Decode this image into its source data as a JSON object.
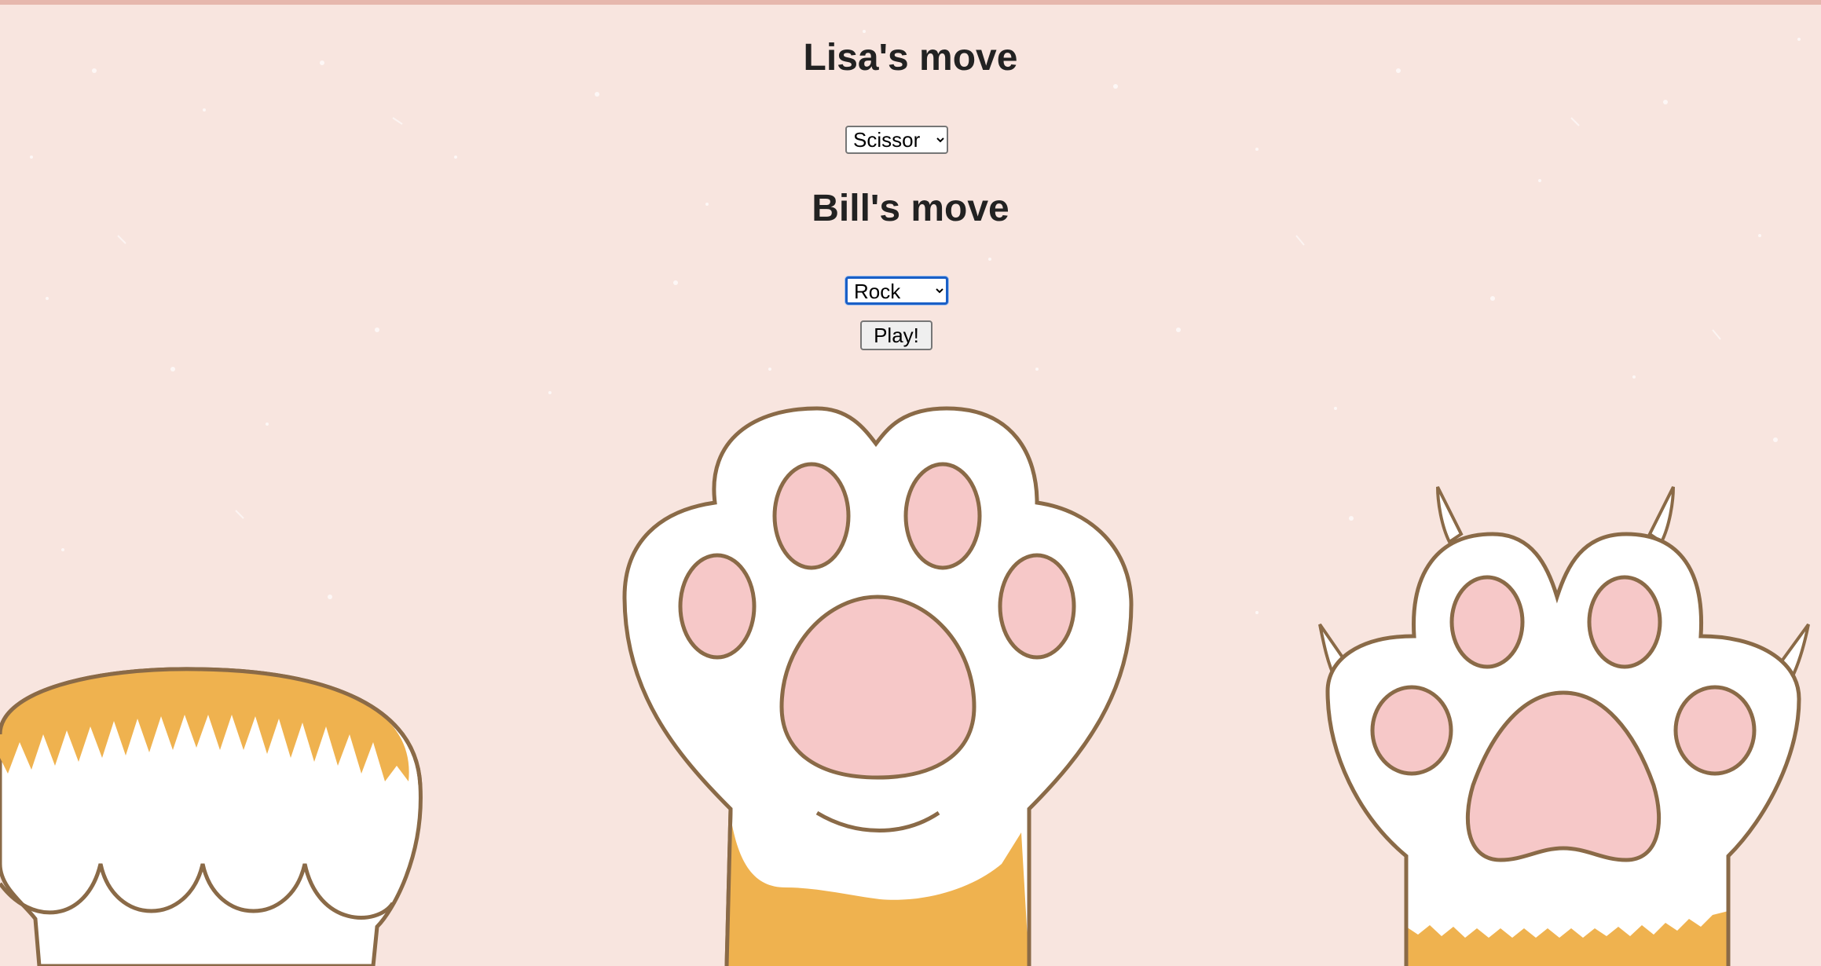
{
  "page": {
    "background_color": "#f8e5df"
  },
  "lisa": {
    "heading": "Lisa's move",
    "selected_move": "Scissor"
  },
  "bill": {
    "heading": "Bill's move",
    "selected_move": "Rock"
  },
  "play_button": {
    "label": "Play!"
  },
  "illustration": {
    "paws": [
      "orange-white-paw-icon",
      "white-paw-icon",
      "clawed-paw-icon"
    ],
    "colors": {
      "fur_white": "#ffffff",
      "fur_orange": "#efb24f",
      "pad_pink": "#f6c8c8",
      "outline": "#8a6a47"
    }
  }
}
